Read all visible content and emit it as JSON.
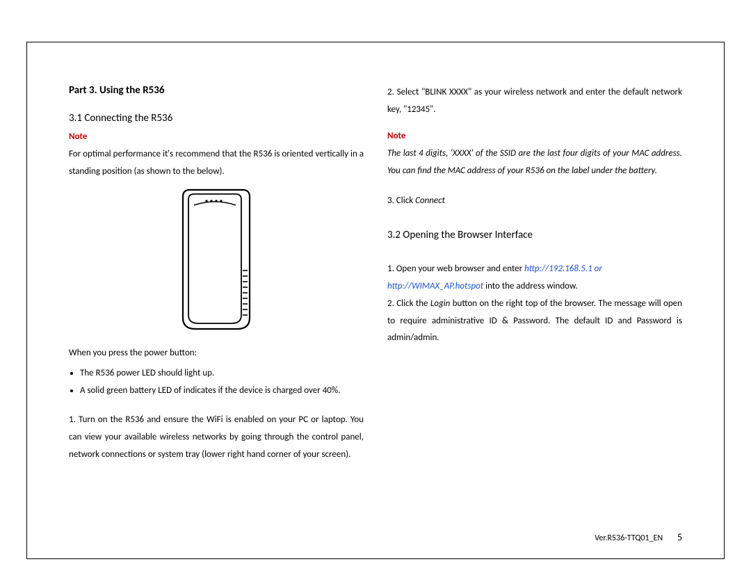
{
  "left": {
    "part_title": "Part 3. Using the R536",
    "section_3_1": "3.1 Connecting the R536",
    "note_label": "Note",
    "orientation_text": "For optimal performance it's recommend that the R536 is oriented vertically in a standing position (as shown to the below).",
    "power_intro": "When you press the power button:",
    "bullet1": "The R536 power LED should light up.",
    "bullet2": "A solid green battery LED of indicates if the device is charged over 40%.",
    "step1": "1. Turn on the R536 and ensure the WiFi is enabled on your PC or laptop. You can view your available wireless networks by going through the control panel, network connections or system tray (lower right hand corner of your screen)."
  },
  "right": {
    "step2": "2. Select \"BLINK XXXX\" as your wireless network and enter the default network key, \"12345\".",
    "note_label": "Note",
    "mac_note": "The last 4 digits, 'XXXX' of the SSID are the last four digits of your MAC address. You can find the MAC address of your R536 on the label under the battery.",
    "step3_prefix": "3. Click ",
    "step3_italic": "Connect",
    "section_3_2": "3.2 Opening the Browser Interface",
    "open1_prefix": "1. Open your web browser and enter ",
    "link1": "http://192.168.5.1 or",
    "link2": "http://WIMAX_AP.hotspot",
    "open1_suffix": " into the address window.",
    "open2_prefix": "2. Click the ",
    "open2_italic": "Login",
    "open2_suffix": " button on the right top of the browser. The message will open to require administrative ID & Password. The default ID and Password is admin/admin."
  },
  "footer": {
    "version": "Ver.R536-TTQ01_EN",
    "page": "5"
  }
}
